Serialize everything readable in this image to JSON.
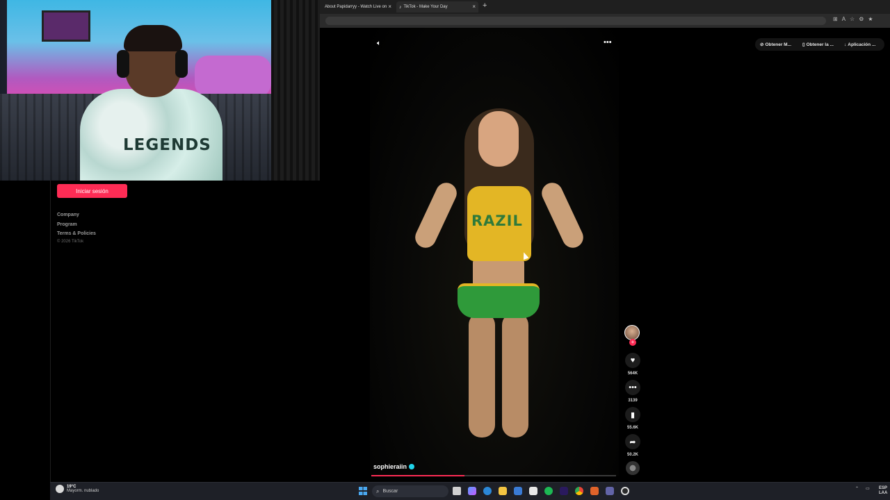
{
  "browser": {
    "tabs": [
      {
        "label": "About Papidarryy - Watch Live on"
      },
      {
        "label": "TikTok - Make Your Day"
      }
    ],
    "new_tab": "+",
    "close": "×"
  },
  "webcam": {
    "shirt_text": "LEGENDS"
  },
  "sidebar": {
    "login_label": "Iniciar sesión",
    "links": [
      "Company",
      "Program",
      "Terms & Policies"
    ],
    "copyright": "© 2026 TikTok"
  },
  "top_actions": [
    {
      "label": "Obtener M..."
    },
    {
      "label": "Obtener la ..."
    },
    {
      "label": "Aplicación ..."
    }
  ],
  "video": {
    "top_text": "RAZIL",
    "username": "sophieraiin",
    "progress_pct": 38
  },
  "actions": {
    "likes": "564K",
    "comments": "3139",
    "saves": "55.6K",
    "shares": "50.2K"
  },
  "taskbar": {
    "weather_temp": "19°C",
    "weather_desc": "Mayorm. nublado",
    "search_placeholder": "Buscar",
    "lang": "ESP",
    "region": "LAA"
  },
  "colors": {
    "accent": "#fe2c55",
    "verified": "#20d5ec"
  }
}
